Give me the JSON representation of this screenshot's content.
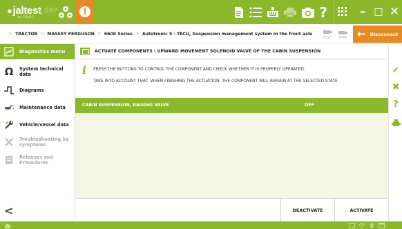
{
  "app": {
    "logo_brand": "jaltest",
    "logo_product": "GRP",
    "logo_sub": "by COJALI",
    "alert_symbol": "!"
  },
  "toolbar": {
    "icons": [
      "report-icon",
      "list-icon",
      "keyboard-icon",
      "print-icon",
      "camera-icon",
      "help-icon",
      "apps-icon"
    ],
    "help_label": "?"
  },
  "window_controls": {
    "minimize": "–",
    "maximize": "□",
    "close": "✕"
  },
  "breadcrumb": {
    "items": [
      "TRACTOR",
      "MASSEY FERGUSON",
      "6600 Series",
      "Autotronic 5 - TECU, Suspension management system in the front axle"
    ]
  },
  "header_right": {
    "test_icon_1": "TEST",
    "test_icon_2": "",
    "disconnect_label": "Disconnect"
  },
  "sidebar": {
    "items": [
      {
        "label": "Diagnostics menu",
        "icon": "diagnostics-icon",
        "active": true,
        "enabled": true
      },
      {
        "label_line1": "System technical",
        "label_line2": "data",
        "icon": "ohm-icon",
        "active": false,
        "enabled": true
      },
      {
        "label": "Diagrams",
        "icon": "diagram-icon",
        "active": false,
        "enabled": true
      },
      {
        "label": "Maintenance data",
        "icon": "oilcan-icon",
        "active": false,
        "enabled": true
      },
      {
        "label": "Vehicle/vessel data",
        "icon": "wrench-icon",
        "active": false,
        "enabled": true
      },
      {
        "label_line1": "Troubleshooting by",
        "label_line2": "symptoms",
        "icon": "tools-icon",
        "active": false,
        "enabled": false
      },
      {
        "label_line1": "Releases and",
        "label_line2": "Procedures",
        "icon": "procedures-icon",
        "active": false,
        "enabled": false
      }
    ],
    "back_symbol": "<"
  },
  "main": {
    "title": "ACTUATE COMPONENTS \\ UPWARD MOVEMENT SOLENOID VALVE OF THE CABIN SUSPENSION",
    "info_line1": "PRESS THE BUTTONS TO CONTROL THE COMPONENT AND CHECK WHETHER IT IS PROPERLY OPERATED.",
    "info_line2": "TAKE INTO ACCOUNT THAT, WHEN FINISHING THE ACTUATION, THE COMPONENT WILL REMAIN AT THE SELECTED STATE.",
    "component": {
      "name": "CABIN SUSPENSION, RAISING VALVE",
      "state": "OFF"
    },
    "buttons": {
      "deactivate": "DEACTIVATE",
      "activate": "ACTIVATE"
    }
  },
  "right_toolbar": {
    "icons": [
      "check-icon",
      "close-icon",
      "help-icon",
      "engine-icon"
    ],
    "check": "✔",
    "close": "✖",
    "help": "?"
  },
  "colors": {
    "brand_green": "#8cb82b",
    "accent_orange": "#e78a26",
    "panel_tint": "#f2f6e3"
  }
}
